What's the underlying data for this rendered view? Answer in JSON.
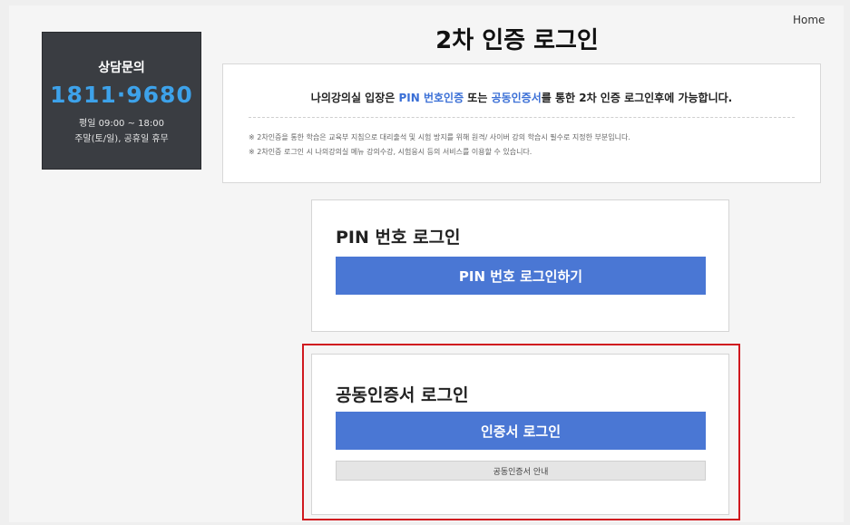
{
  "header": {
    "home_link": "Home",
    "page_title": "2차 인증 로그인"
  },
  "contact": {
    "label": "상담문의",
    "phone": "1811·9680",
    "hours": "평일 09:00 ~ 18:00",
    "closed": "주말(토/일), 공휴일 휴무"
  },
  "notice": {
    "main_prefix": "나의강의실 입장은 ",
    "pin_highlight": "PIN 번호인증",
    "main_mid": " 또는 ",
    "cert_highlight": "공동인증서",
    "main_suffix": "를 통한 2차 인증 로그인후에 가능합니다.",
    "note1": "※ 2차인증을 통한 학습은 교육부 지침으로 대리출석 및 시험 방지를 위해 원격/ 사이버 강의 학습시 필수로 지정한 부분입니다.",
    "note2": "※ 2차인증 로그인 시 나의강의실 메뉴 강의수강, 시험응시 등의 서비스를 이용할 수 있습니다."
  },
  "pin_card": {
    "title": "PIN 번호 로그인",
    "button_label": "PIN 번호 로그인하기"
  },
  "cert_card": {
    "title": "공동인증서 로그인",
    "button_label": "인증서 로그인",
    "guide_label": "공동인증서 안내"
  },
  "colors": {
    "accent_blue": "#4a77d4",
    "phone_blue": "#3da2ea",
    "highlight_red": "#d0191f",
    "contact_bg": "#3a3d42"
  }
}
